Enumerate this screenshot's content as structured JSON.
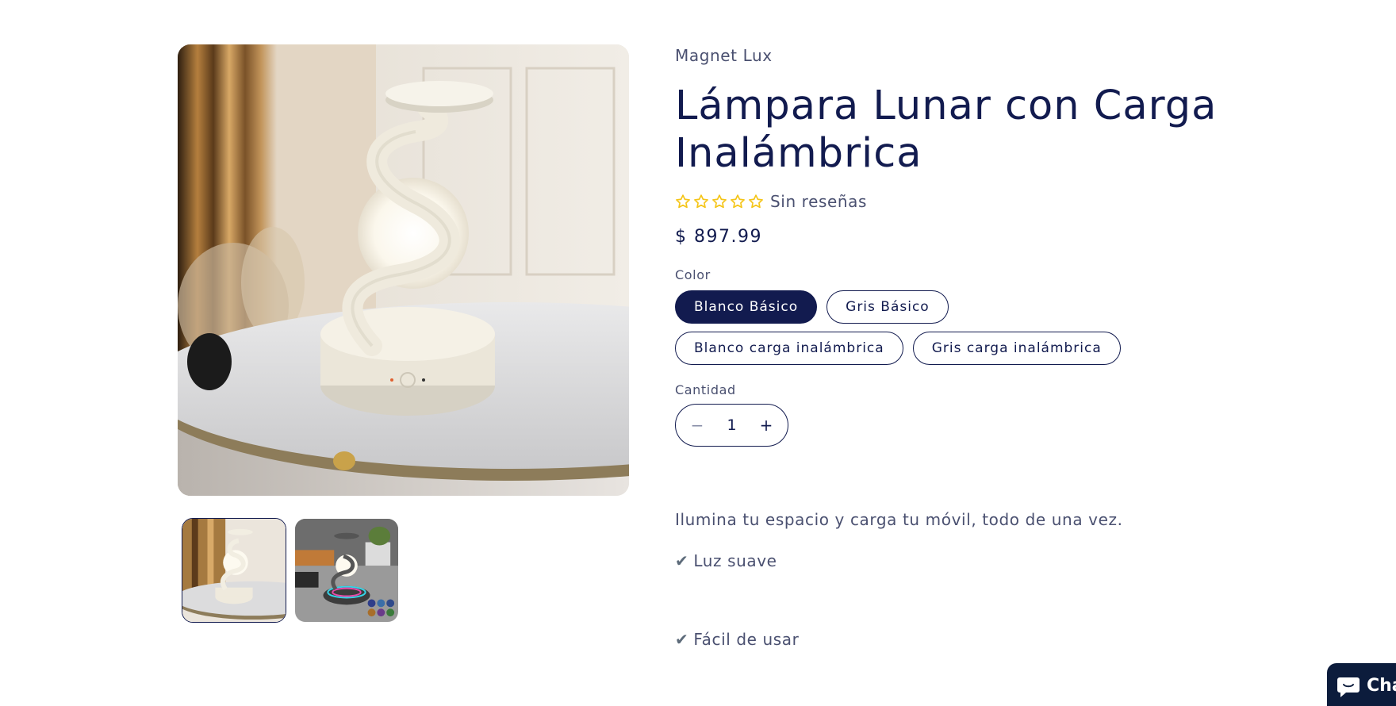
{
  "product": {
    "vendor": "Magnet Lux",
    "title": "Lámpara Lunar con Carga Inalámbrica",
    "rating": {
      "stars": 0,
      "max": 5,
      "text": "Sin reseñas"
    },
    "price": "$ 897.99",
    "color_label": "Color",
    "colors": [
      {
        "label": "Blanco Básico",
        "selected": true
      },
      {
        "label": "Gris Básico",
        "selected": false
      },
      {
        "label": "Blanco carga inalámbrica",
        "selected": false
      },
      {
        "label": "Gris carga inalámbrica",
        "selected": false
      }
    ],
    "quantity_label": "Cantidad",
    "quantity": "1",
    "minus_symbol": "−",
    "plus_symbol": "+",
    "description": "Ilumina tu espacio y carga tu móvil, todo de una vez.",
    "features": [
      {
        "check": "✔",
        "text": "Luz suave"
      },
      {
        "check": "✔",
        "text": "Fácil de usar"
      }
    ]
  },
  "gallery": {
    "thumbnails": [
      {
        "name": "white-lamp",
        "active": true
      },
      {
        "name": "grey-lamp",
        "active": false
      }
    ]
  },
  "chat": {
    "label": "Chat",
    "icon": "chat-bubble-icon"
  },
  "colors": {
    "primary": "#121b4f",
    "star": "#f5c518",
    "muted": "#4a5070",
    "chat_bg": "#0c1c3c"
  }
}
